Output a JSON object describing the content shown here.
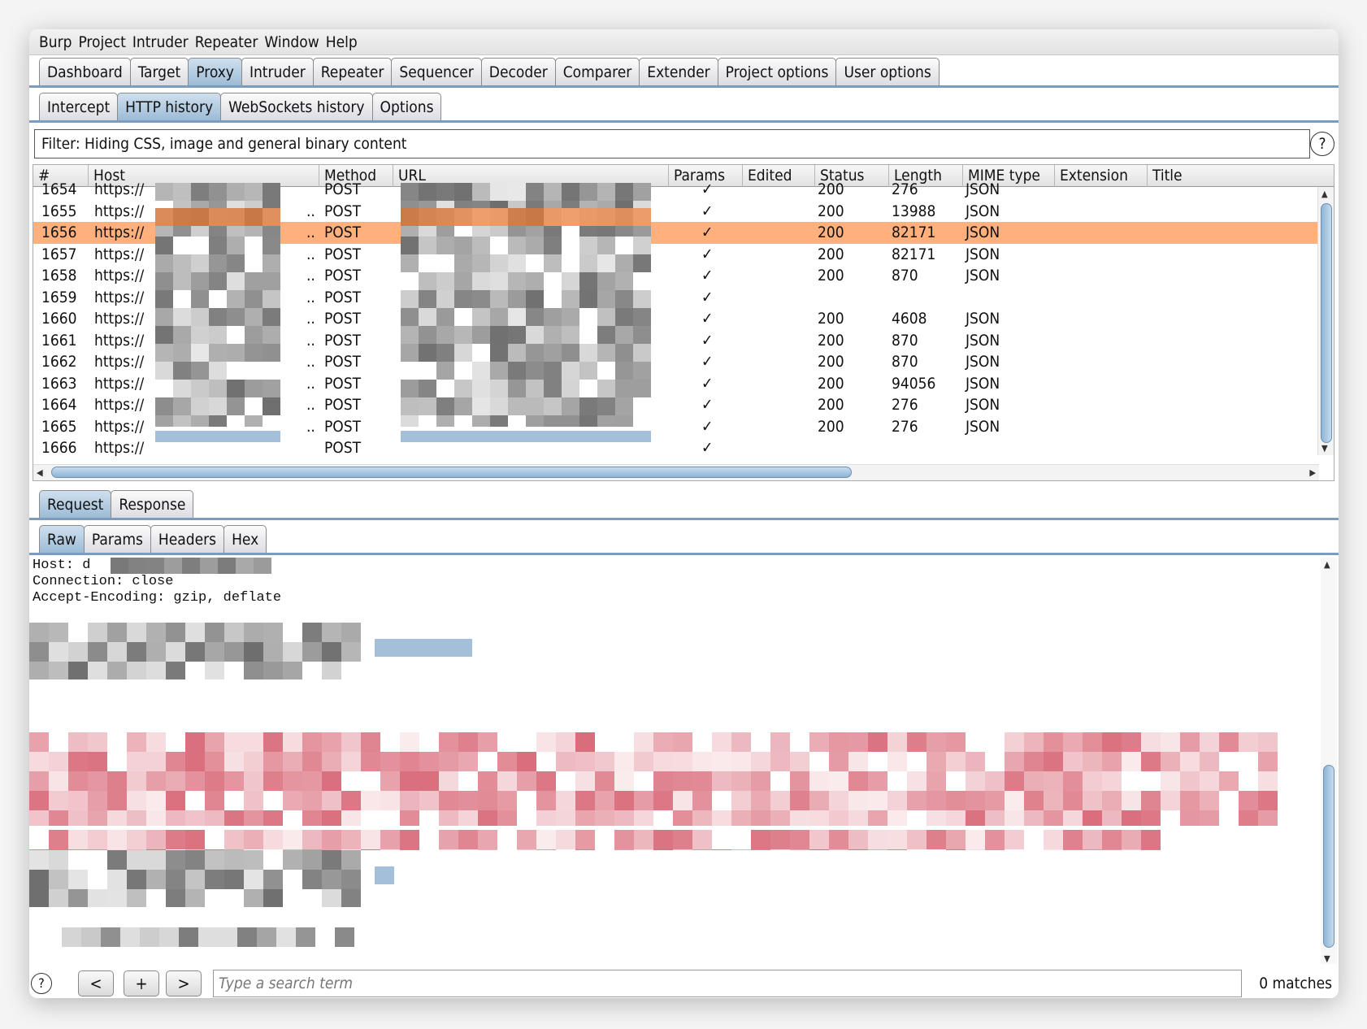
{
  "menu": [
    "Burp",
    "Project",
    "Intruder",
    "Repeater",
    "Window",
    "Help"
  ],
  "main_tabs": [
    "Dashboard",
    "Target",
    "Proxy",
    "Intruder",
    "Repeater",
    "Sequencer",
    "Decoder",
    "Comparer",
    "Extender",
    "Project options",
    "User options"
  ],
  "main_tab_active": "Proxy",
  "proxy_tabs": [
    "Intercept",
    "HTTP history",
    "WebSockets history",
    "Options"
  ],
  "proxy_tab_active": "HTTP history",
  "filter": "Filter: Hiding CSS, image and general binary content",
  "columns": [
    "#",
    "Host",
    "Method",
    "URL",
    "Params",
    "Edited",
    "Status",
    "Length",
    "MIME type",
    "Extension",
    "Title"
  ],
  "rows": [
    {
      "id": "1654",
      "host": "https://",
      "method": "POST",
      "params": "✓",
      "status": "200",
      "length": "276",
      "mime": "JSON"
    },
    {
      "id": "1655",
      "host": "https://",
      "method": "POST",
      "params": "✓",
      "status": "200",
      "length": "13988",
      "mime": "JSON"
    },
    {
      "id": "1656",
      "host": "https://",
      "method": "POST",
      "params": "✓",
      "status": "200",
      "length": "82171",
      "mime": "JSON",
      "selected": true
    },
    {
      "id": "1657",
      "host": "https://",
      "method": "POST",
      "params": "✓",
      "status": "200",
      "length": "82171",
      "mime": "JSON"
    },
    {
      "id": "1658",
      "host": "https://",
      "method": "POST",
      "params": "✓",
      "status": "200",
      "length": "870",
      "mime": "JSON"
    },
    {
      "id": "1659",
      "host": "https://",
      "method": "POST",
      "params": "✓",
      "status": "",
      "length": "",
      "mime": ""
    },
    {
      "id": "1660",
      "host": "https://",
      "method": "POST",
      "params": "✓",
      "status": "200",
      "length": "4608",
      "mime": "JSON"
    },
    {
      "id": "1661",
      "host": "https://",
      "method": "POST",
      "params": "✓",
      "status": "200",
      "length": "870",
      "mime": "JSON"
    },
    {
      "id": "1662",
      "host": "https://",
      "method": "POST",
      "params": "✓",
      "status": "200",
      "length": "870",
      "mime": "JSON"
    },
    {
      "id": "1663",
      "host": "https://",
      "method": "POST",
      "params": "✓",
      "status": "200",
      "length": "94056",
      "mime": "JSON"
    },
    {
      "id": "1664",
      "host": "https://",
      "method": "POST",
      "params": "✓",
      "status": "200",
      "length": "276",
      "mime": "JSON"
    },
    {
      "id": "1665",
      "host": "https://",
      "method": "POST",
      "params": "✓",
      "status": "200",
      "length": "276",
      "mime": "JSON"
    },
    {
      "id": "1666",
      "host": "https://",
      "method": "POST",
      "params": "✓",
      "status": "",
      "length": "",
      "mime": ""
    }
  ],
  "selected_row_color": "#ffb07d",
  "message_tabs": [
    "Request",
    "Response"
  ],
  "message_tab_active": "Request",
  "view_tabs": [
    "Raw",
    "Params",
    "Headers",
    "Hex"
  ],
  "view_tab_active": "Raw",
  "raw_lines": [
    "Host: d",
    "Connection: close",
    "Accept-Encoding: gzip, deflate"
  ],
  "search": {
    "placeholder": "Type a search term",
    "matches": "0 matches",
    "prev": "<",
    "add": "+",
    "next": ">",
    "help": "?"
  },
  "filter_help": "?"
}
